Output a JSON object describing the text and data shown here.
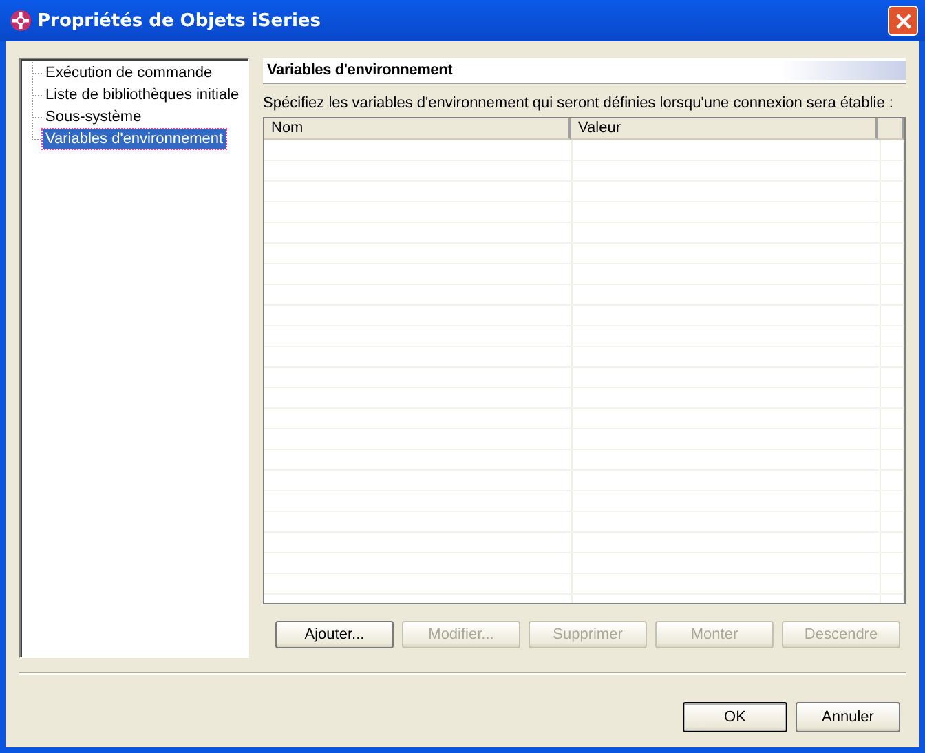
{
  "window": {
    "title": "Propriétés de Objets iSeries"
  },
  "tree": {
    "items": [
      {
        "label": "Exécution de commande",
        "selected": false
      },
      {
        "label": "Liste de bibliothèques initiale",
        "selected": false
      },
      {
        "label": "Sous-système",
        "selected": false
      },
      {
        "label": "Variables d'environnement",
        "selected": true
      }
    ]
  },
  "page": {
    "title": "Variables d'environnement",
    "description": "Spécifiez les variables d'environnement qui seront définies lorsqu'une connexion sera établie :"
  },
  "table": {
    "columns": [
      "Nom",
      "Valeur"
    ]
  },
  "actions": [
    {
      "label": "Ajouter...",
      "disabled": false
    },
    {
      "label": "Modifier...",
      "disabled": true
    },
    {
      "label": "Supprimer",
      "disabled": true
    },
    {
      "label": "Monter",
      "disabled": true
    },
    {
      "label": "Descendre",
      "disabled": true
    }
  ],
  "buttons": [
    {
      "label": "OK",
      "default": true
    },
    {
      "label": "Annuler",
      "default": false
    }
  ]
}
